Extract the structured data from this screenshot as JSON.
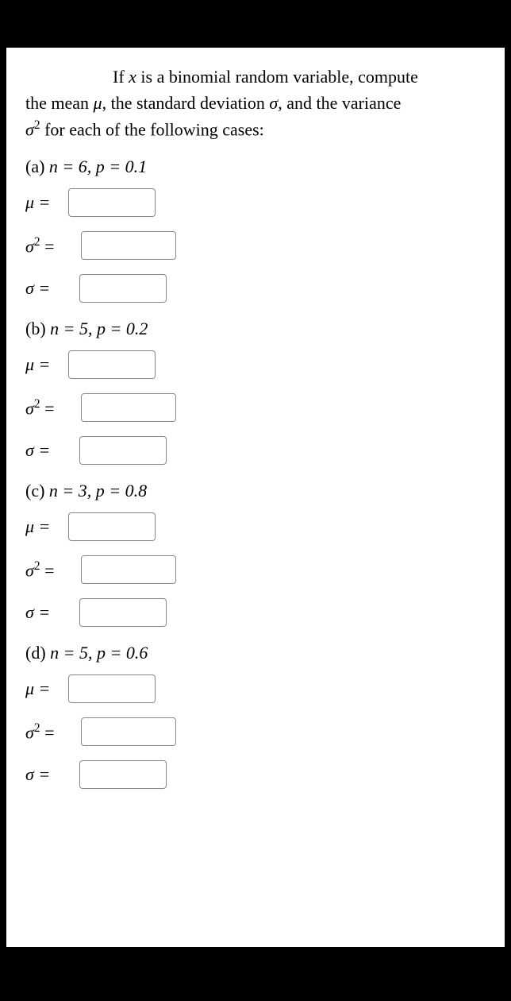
{
  "intro": {
    "line1_prefix": "If ",
    "var_x": "x",
    "line1_rest": " is a binomial random variable, compute",
    "line2_a": "the mean ",
    "mu": "μ",
    "line2_b": ", the standard deviation ",
    "sigma": "σ",
    "line2_c": ", and the variance",
    "line3_a": "σ",
    "line3_sup": "2",
    "line3_b": " for each of the following cases:"
  },
  "labels": {
    "mu_eq": "μ =",
    "sigma_eq": "σ =",
    "sigma2_a": "σ",
    "sigma2_sup": "2",
    "sigma2_b": " ="
  },
  "cases": {
    "a": {
      "letter": "(a) ",
      "n_eq": "n = 6, p = 0.1"
    },
    "b": {
      "letter": "(b) ",
      "n_eq": "n = 5, p = 0.2"
    },
    "c": {
      "letter": "(c) ",
      "n_eq": "n = 3, p = 0.8"
    },
    "d": {
      "letter": "(d) ",
      "n_eq": "n = 5, p = 0.6"
    }
  }
}
